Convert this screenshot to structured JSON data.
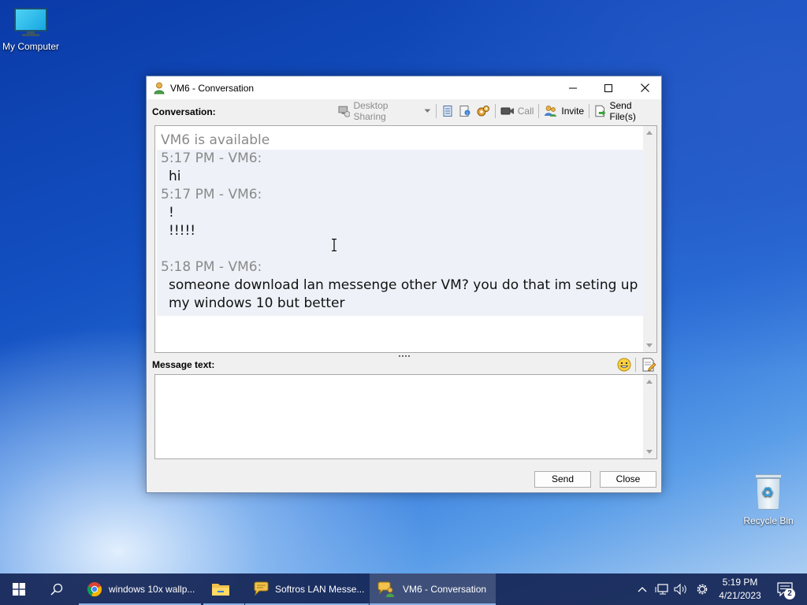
{
  "desktop": {
    "icons": [
      {
        "label": "My Computer",
        "icon": "computer-icon"
      },
      {
        "label": "Recycle Bin",
        "icon": "recycle-bin-icon"
      }
    ]
  },
  "window": {
    "title": "VM6 - Conversation",
    "icon": "user-icon",
    "conversation_label": "Conversation:",
    "message_label": "Message text:",
    "toolbar": {
      "desktop_sharing": "Desktop Sharing",
      "call": "Call",
      "invite": "Invite",
      "send_files": "Send File(s)"
    },
    "conversation": {
      "status": "VM6 is available",
      "messages": [
        {
          "header": "5:17 PM - VM6:",
          "lines": [
            "hi"
          ]
        },
        {
          "header": "5:17 PM - VM6:",
          "lines": [
            "!",
            "!!!!!"
          ]
        },
        {
          "header": "5:18 PM - VM6:",
          "lines": [
            "someone download lan messenge other VM? you do that im seting up",
            "my windows 10 but better"
          ]
        }
      ]
    },
    "message_input": {
      "value": "",
      "placeholder": ""
    },
    "buttons": {
      "send": "Send",
      "close": "Close"
    }
  },
  "taskbar": {
    "tasks": [
      {
        "label": "windows 10x wallp...",
        "icon": "chrome-icon"
      },
      {
        "label": "",
        "icon": "folder-icon"
      },
      {
        "label": "Softros LAN Messe...",
        "icon": "lan-messenger-icon"
      },
      {
        "label": "VM6 - Conversation",
        "icon": "conversation-icon",
        "active": true
      }
    ],
    "clock": {
      "time": "5:19 PM",
      "date": "4/21/2023"
    },
    "notification_count": "2"
  },
  "colors": {
    "taskbar": "#142656",
    "window_bg": "#f0f0f0",
    "message_block_bg": "#eef2f8",
    "header_text": "#8a8a8a"
  }
}
